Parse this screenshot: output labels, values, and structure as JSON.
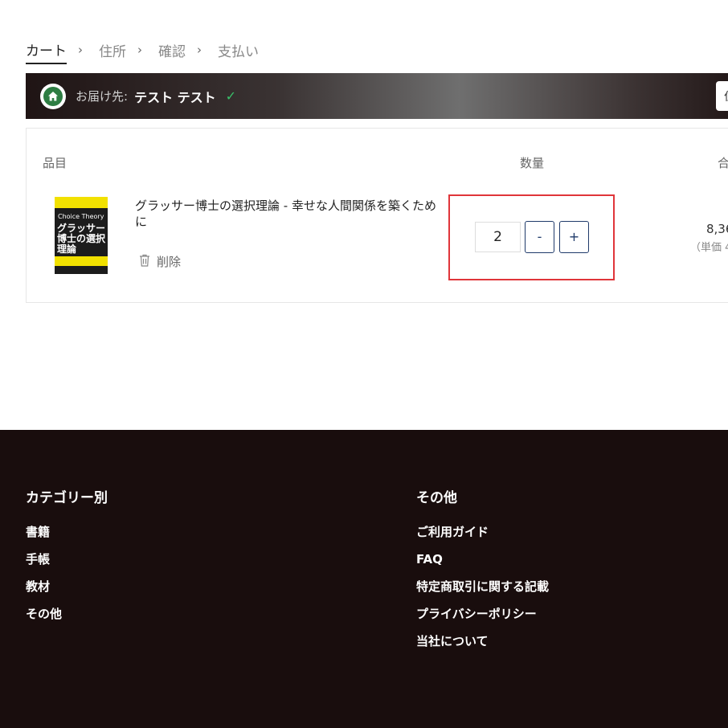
{
  "breadcrumb": {
    "steps": [
      "カート",
      "住所",
      "確認",
      "支払い"
    ],
    "separator": "›"
  },
  "delivery": {
    "label": "お届け先:",
    "name": "テスト テスト",
    "check": "✓",
    "change_button": "住所"
  },
  "cart": {
    "headers": {
      "item": "品目",
      "quantity": "数量",
      "total": "合計"
    },
    "items": [
      {
        "title": "グラッサー博士の選択理論 - 幸せな人間関係を築くために",
        "cover": {
          "top_text": "Choice Theory",
          "title_text": "グラッサー博士の選択理論",
          "colors": {
            "background": "#f2e100",
            "band": "#1c1c1c"
          }
        },
        "delete_label": "削除",
        "quantity": "2",
        "minus_label": "-",
        "plus_label": "+",
        "total": "8,36",
        "unit_price": "（単価 4"
      }
    ]
  },
  "footer": {
    "columns": [
      {
        "heading": "カテゴリー別",
        "links": [
          "書籍",
          "手帳",
          "教材",
          "その他"
        ]
      },
      {
        "heading": "その他",
        "links": [
          "ご利用ガイド",
          "FAQ",
          "特定商取引に関する記載",
          "プライバシーポリシー",
          "当社について"
        ]
      }
    ]
  },
  "colors": {
    "highlight": "#e0353a",
    "footer_bg": "#190d0d",
    "qty_button": "#1f3a6a",
    "home_icon": "#2e7d43",
    "check": "#39c06a"
  }
}
